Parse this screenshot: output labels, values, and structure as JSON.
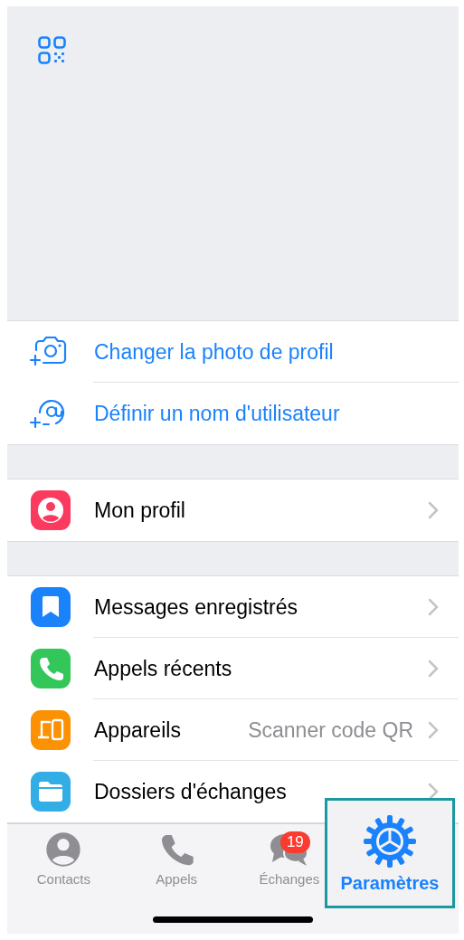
{
  "header": {
    "kind": "qr"
  },
  "actions": [
    {
      "label": "Changer la photo de profil",
      "kind": "camera"
    },
    {
      "label": "Définir un nom d'utilisateur",
      "kind": "at"
    }
  ],
  "profile": [
    {
      "label": "Mon profil",
      "kind": "person",
      "color": "#fb3a5f"
    }
  ],
  "menu": [
    {
      "label": "Messages enregistrés",
      "kind": "bookmark",
      "color": "#1a82fb"
    },
    {
      "label": "Appels récents",
      "kind": "phone",
      "color": "#33c759"
    },
    {
      "label": "Appareils",
      "kind": "devices",
      "color": "#fb9103",
      "detail": "Scanner code QR"
    },
    {
      "label": "Dossiers d'échanges",
      "kind": "folder",
      "color": "#32ade6"
    }
  ],
  "tabs": [
    {
      "label": "Contacts",
      "kind": "person",
      "selected": false
    },
    {
      "label": "Appels",
      "kind": "phone",
      "selected": false
    },
    {
      "label": "Échanges",
      "kind": "chat",
      "selected": false,
      "badge": "19"
    },
    {
      "label": "Paramètres",
      "kind": "gear",
      "selected": true,
      "highlighted": true
    }
  ]
}
